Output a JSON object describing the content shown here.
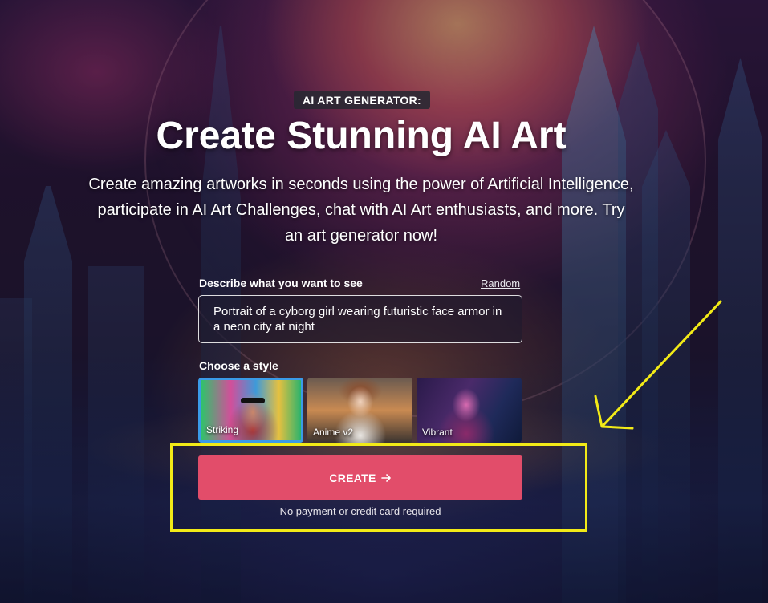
{
  "hero": {
    "tag": "AI ART GENERATOR:",
    "headline": "Create Stunning AI Art",
    "subtitle": "Create amazing artworks in seconds using the power of Artificial Intelligence, participate in AI Art Challenges, chat with AI Art enthusiasts, and more. Try an art generator now!"
  },
  "form": {
    "describe_label": "Describe what you want to see",
    "random_label": "Random",
    "prompt_value": "Portrait of a cyborg girl wearing futuristic face armor in a neon city at night",
    "style_label": "Choose a style",
    "styles": [
      {
        "name": "Striking",
        "selected": true
      },
      {
        "name": "Anime v2",
        "selected": false
      },
      {
        "name": "Vibrant",
        "selected": false
      }
    ],
    "create_label": "CREATE",
    "create_icon": "arrow-right-icon",
    "note": "No payment or credit card required"
  },
  "annotation": {
    "highlight_color": "#f2ea17"
  },
  "colors": {
    "create_button": "#e24d6a",
    "selected_border": "#3a9be8"
  }
}
